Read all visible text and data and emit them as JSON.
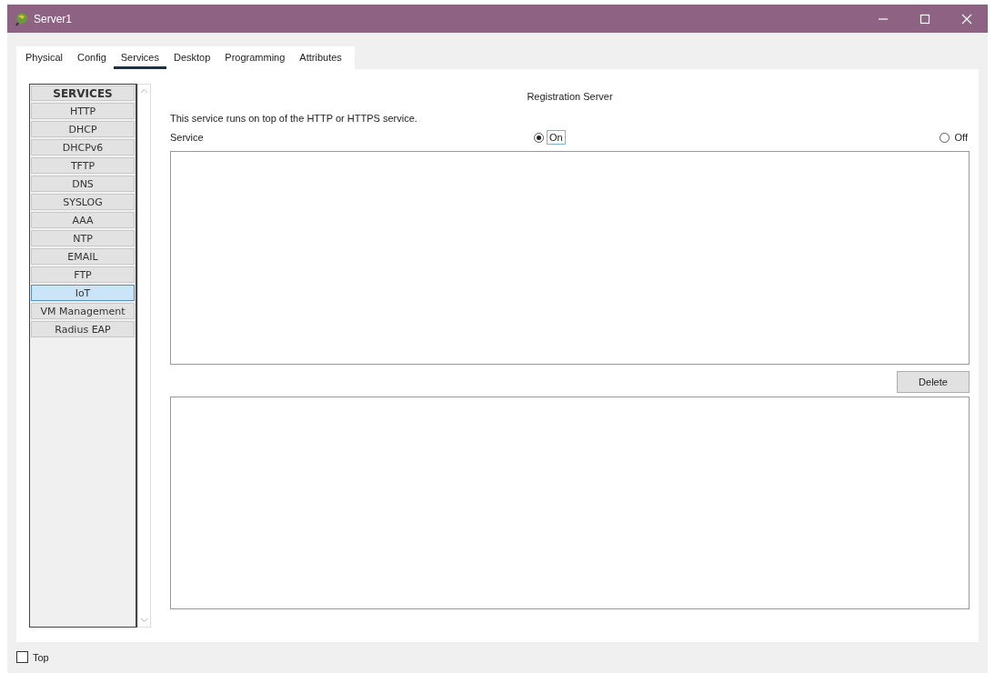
{
  "window": {
    "title": "Server1"
  },
  "tabs": [
    {
      "label": "Physical",
      "selected": false
    },
    {
      "label": "Config",
      "selected": false
    },
    {
      "label": "Services",
      "selected": true
    },
    {
      "label": "Desktop",
      "selected": false
    },
    {
      "label": "Programming",
      "selected": false
    },
    {
      "label": "Attributes",
      "selected": false
    }
  ],
  "sidebar": {
    "header": "SERVICES",
    "items": [
      {
        "label": "HTTP",
        "selected": false
      },
      {
        "label": "DHCP",
        "selected": false
      },
      {
        "label": "DHCPv6",
        "selected": false
      },
      {
        "label": "TFTP",
        "selected": false
      },
      {
        "label": "DNS",
        "selected": false
      },
      {
        "label": "SYSLOG",
        "selected": false
      },
      {
        "label": "AAA",
        "selected": false
      },
      {
        "label": "NTP",
        "selected": false
      },
      {
        "label": "EMAIL",
        "selected": false
      },
      {
        "label": "FTP",
        "selected": false
      },
      {
        "label": "IoT",
        "selected": true
      },
      {
        "label": "VM Management",
        "selected": false
      },
      {
        "label": "Radius EAP",
        "selected": false
      }
    ]
  },
  "panel": {
    "title": "Registration Server",
    "note": "This service runs on top of the HTTP or HTTPS service.",
    "service_label": "Service",
    "options": [
      {
        "label": "On",
        "selected": true
      },
      {
        "label": "Off",
        "selected": false
      }
    ],
    "delete_button": "Delete"
  },
  "footer": {
    "checkbox": {
      "label": "Top",
      "checked": false
    }
  }
}
